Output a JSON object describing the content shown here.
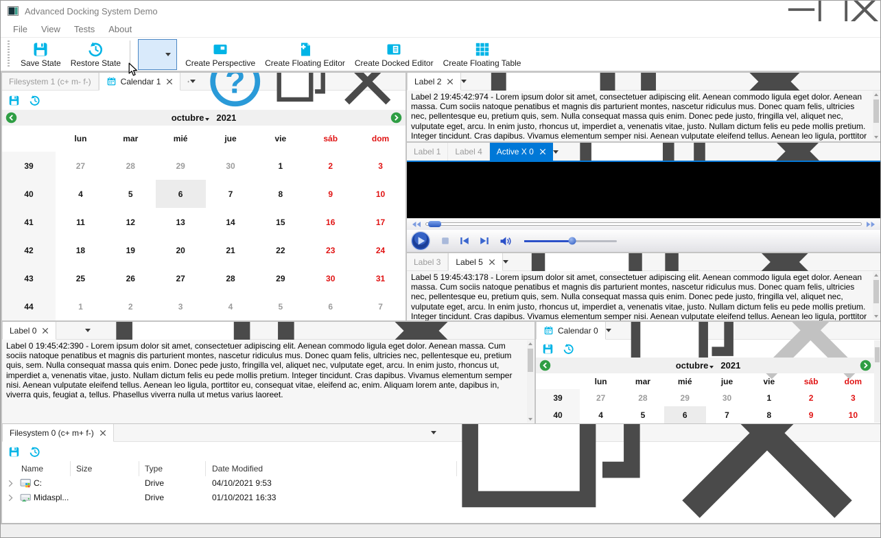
{
  "titlebar": {
    "title": "Advanced Docking System Demo"
  },
  "menubar": {
    "items": [
      "File",
      "View",
      "Tests",
      "About"
    ]
  },
  "toolbar": {
    "save_state": "Save State",
    "restore_state": "Restore State",
    "create_perspective": "Create Perspective",
    "create_floating_editor": "Create Floating Editor",
    "create_docked_editor": "Create Docked Editor",
    "create_floating_table": "Create Floating Table"
  },
  "colors": {
    "accent_cyan": "#00b4e6",
    "active_tab_blue": "#0078d7",
    "weekend_red": "#e01313",
    "nav_green": "#2f9e44"
  },
  "filesystem1_panel": {
    "tab": "Filesystem 1 (c+ m- f-)"
  },
  "calendar1_panel": {
    "tab": "Calendar 1"
  },
  "label2_panel": {
    "tab": "Label 2",
    "text": "Label 2 19:45:42:974 - Lorem ipsum dolor sit amet, consectetuer adipiscing elit. Aenean commodo ligula eget dolor. Aenean massa. Cum sociis natoque penatibus et magnis dis parturient montes, nascetur ridiculus mus. Donec quam felis, ultricies nec, pellentesque eu, pretium quis, sem. Nulla consequat massa quis enim. Donec pede justo, fringilla vel, aliquet nec, vulputate eget, arcu. In enim justo, rhoncus ut, imperdiet a, venenatis vitae, justo. Nullam dictum felis eu pede mollis pretium. Integer tincidunt. Cras dapibus. Vivamus elementum semper nisi. Aenean vulputate eleifend tellus. Aenean leo ligula, porttitor eu, consequat vitae, eleifend ac, enim. Aliquam"
  },
  "activex_panel": {
    "tab_label1": "Label 1",
    "tab_label4": "Label 4",
    "tab_active": "Active X 0"
  },
  "label5_panel": {
    "tab_label3": "Label 3",
    "tab_label5": "Label 5",
    "text": "Label 5 19:45:43:178 - Lorem ipsum dolor sit amet, consectetuer adipiscing elit. Aenean commodo ligula eget dolor. Aenean massa. Cum sociis natoque penatibus et magnis dis parturient montes, nascetur ridiculus mus. Donec quam felis, ultricies nec, pellentesque eu, pretium quis, sem. Nulla consequat massa quis enim. Donec pede justo, fringilla vel, aliquet nec, vulputate eget, arcu. In enim justo, rhoncus ut, imperdiet a, venenatis vitae, justo. Nullam dictum felis eu pede mollis pretium. Integer tincidunt. Cras dapibus. Vivamus elementum semper nisi. Aenean vulputate eleifend tellus. Aenean leo ligula, porttitor eu, consequat vitae, eleifend ac, enim. Aliquam"
  },
  "label0_panel": {
    "tab": "Label 0",
    "text": "Label 0 19:45:42:390 - Lorem ipsum dolor sit amet, consectetuer adipiscing elit. Aenean commodo ligula eget dolor. Aenean massa. Cum sociis natoque penatibus et magnis dis parturient montes, nascetur ridiculus mus. Donec quam felis, ultricies nec, pellentesque eu, pretium quis, sem. Nulla consequat massa quis enim. Donec pede justo, fringilla vel, aliquet nec, vulputate eget, arcu. In enim justo, rhoncus ut, imperdiet a, venenatis vitae, justo. Nullam dictum felis eu pede mollis pretium. Integer tincidunt. Cras dapibus. Vivamus elementum semper nisi. Aenean vulputate eleifend tellus. Aenean leo ligula, porttitor eu, consequat vitae, eleifend ac, enim. Aliquam lorem ante, dapibus in, viverra quis, feugiat a, tellus. Phasellus viverra nulla ut metus varius laoreet."
  },
  "calendar0_panel": {
    "tab": "Calendar 0"
  },
  "filesystem0_panel": {
    "tab": "Filesystem 0 (c+ m+ f-)",
    "headers": [
      "Name",
      "Size",
      "Type",
      "Date Modified"
    ],
    "rows": [
      {
        "name": "C:",
        "size": "",
        "type": "Drive",
        "date_modified": "04/10/2021 9:53",
        "icon": "drivec"
      },
      {
        "name": "Midaspl...",
        "size": "",
        "type": "Drive",
        "date_modified": "01/10/2021 16:33",
        "icon": "drive2"
      }
    ]
  },
  "calendar": {
    "month": "octubre",
    "year": "2021",
    "weekdays": [
      {
        "label": "lun",
        "weekend": false
      },
      {
        "label": "mar",
        "weekend": false
      },
      {
        "label": "mié",
        "weekend": false
      },
      {
        "label": "jue",
        "weekend": false
      },
      {
        "label": "vie",
        "weekend": false
      },
      {
        "label": "sáb",
        "weekend": true
      },
      {
        "label": "dom",
        "weekend": true
      }
    ],
    "weeks": [
      {
        "week": "39",
        "days": [
          {
            "d": "27",
            "muted": true
          },
          {
            "d": "28",
            "muted": true
          },
          {
            "d": "29",
            "muted": true
          },
          {
            "d": "30",
            "muted": true
          },
          {
            "d": "1"
          },
          {
            "d": "2",
            "weekend": true
          },
          {
            "d": "3",
            "weekend": true
          }
        ]
      },
      {
        "week": "40",
        "days": [
          {
            "d": "4"
          },
          {
            "d": "5"
          },
          {
            "d": "6",
            "selected": true
          },
          {
            "d": "7"
          },
          {
            "d": "8"
          },
          {
            "d": "9",
            "weekend": true
          },
          {
            "d": "10",
            "weekend": true
          }
        ]
      },
      {
        "week": "41",
        "days": [
          {
            "d": "11"
          },
          {
            "d": "12"
          },
          {
            "d": "13"
          },
          {
            "d": "14"
          },
          {
            "d": "15"
          },
          {
            "d": "16",
            "weekend": true
          },
          {
            "d": "17",
            "weekend": true
          }
        ]
      },
      {
        "week": "42",
        "days": [
          {
            "d": "18"
          },
          {
            "d": "19"
          },
          {
            "d": "20"
          },
          {
            "d": "21"
          },
          {
            "d": "22"
          },
          {
            "d": "23",
            "weekend": true
          },
          {
            "d": "24",
            "weekend": true
          }
        ]
      },
      {
        "week": "43",
        "days": [
          {
            "d": "25"
          },
          {
            "d": "26"
          },
          {
            "d": "27"
          },
          {
            "d": "28"
          },
          {
            "d": "29"
          },
          {
            "d": "30",
            "weekend": true
          },
          {
            "d": "31",
            "weekend": true
          }
        ]
      },
      {
        "week": "44",
        "days": [
          {
            "d": "1",
            "muted": true
          },
          {
            "d": "2",
            "muted": true
          },
          {
            "d": "3",
            "muted": true
          },
          {
            "d": "4",
            "muted": true
          },
          {
            "d": "5",
            "muted": true
          },
          {
            "d": "6",
            "muted": true
          },
          {
            "d": "7",
            "muted": true
          }
        ]
      }
    ],
    "selected_day": "6"
  },
  "statusbar": {
    "text": ""
  }
}
